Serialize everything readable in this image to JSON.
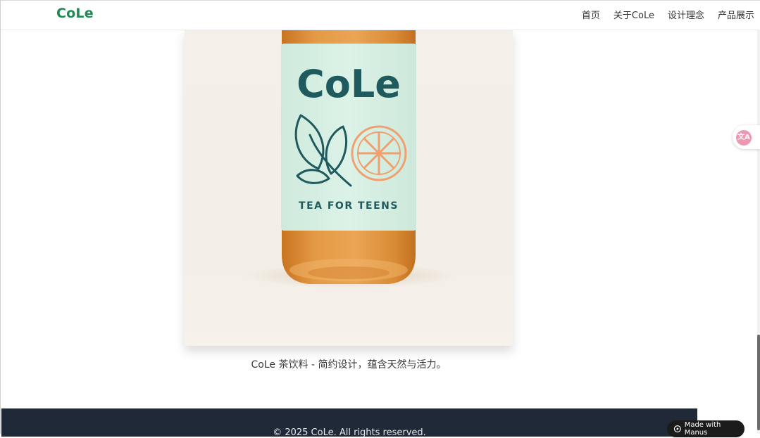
{
  "header": {
    "logo": "CoLe",
    "nav": [
      "首页",
      "关于CoLe",
      "设计理念",
      "产品展示"
    ]
  },
  "product": {
    "image_alt": "CoLe tea bottle",
    "label_brand": "CoLe",
    "label_tagline": "TEA FOR TEENS",
    "caption": "CoLe 茶饮料 - 简约设计，蕴含天然与活力。"
  },
  "footer": {
    "copyright": "© 2025 CoLe. All rights reserved."
  },
  "widgets": {
    "translate_icon": "translate-icon",
    "translate_glyph": "文A",
    "manus_badge": "Made with Manus"
  },
  "colors": {
    "brand_green": "#1f8a53",
    "footer_bg": "#1f2937",
    "label_mint": "#d6efe4",
    "label_teal": "#1f5a5e",
    "orange": "#f0a06e",
    "tea": "#d98a33"
  }
}
